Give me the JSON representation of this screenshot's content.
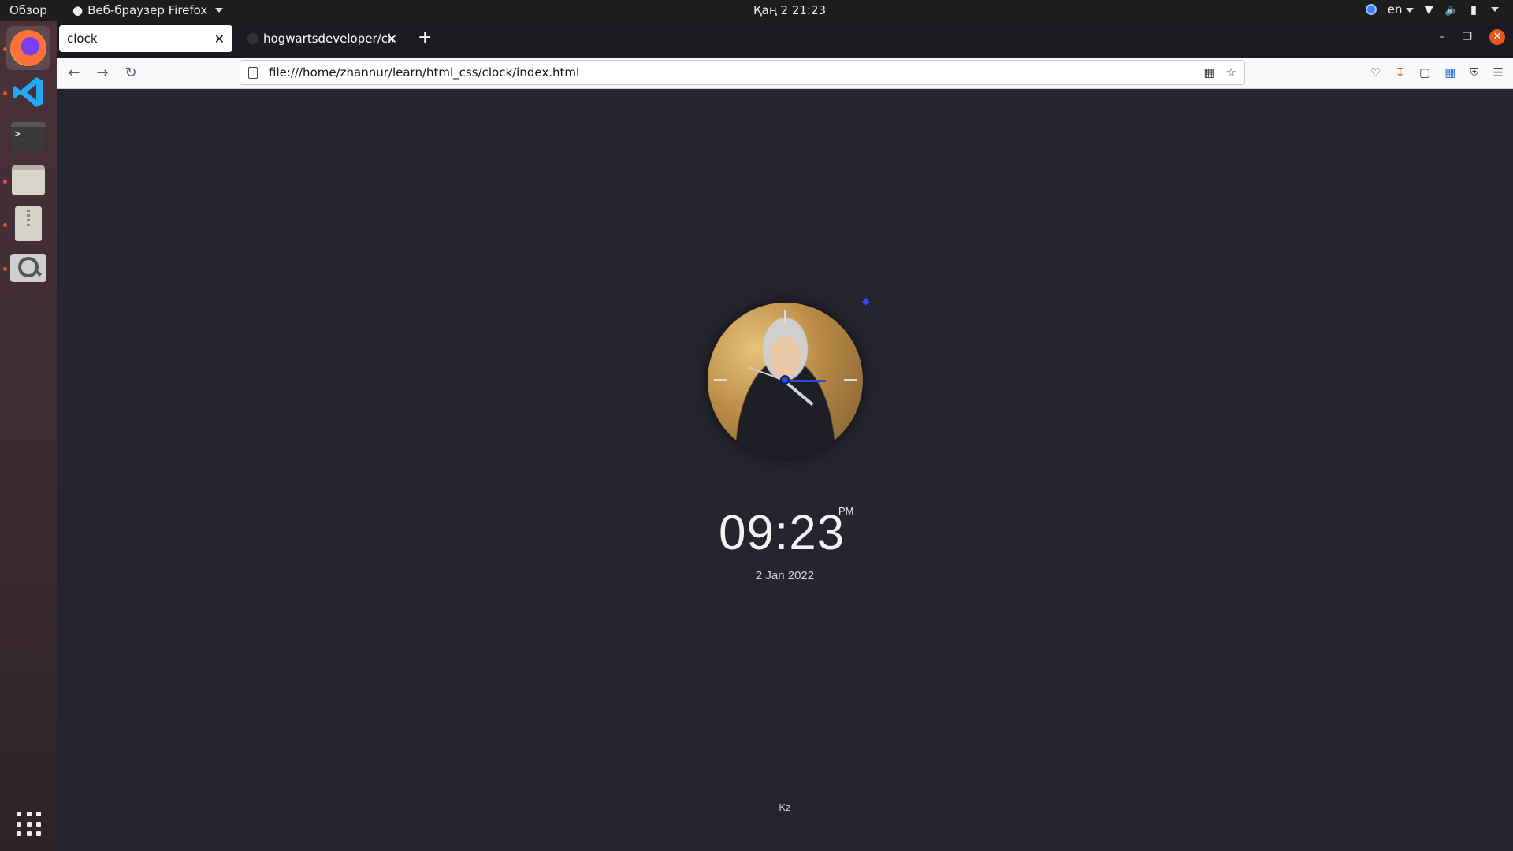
{
  "topbar": {
    "overview": "Обзор",
    "app_menu": "Веб-браузер Firefox",
    "clock": "Қаң 2  21:23",
    "lang": "en"
  },
  "dock": {
    "apps": [
      "firefox-icon",
      "vscode-icon",
      "terminal-icon",
      "files-icon",
      "archive-manager-icon",
      "image-viewer-icon"
    ]
  },
  "browser": {
    "tabs": [
      {
        "title": "clock",
        "active": true
      },
      {
        "title": "hogwartsdeveloper/clock",
        "active": false
      }
    ],
    "url": "file:///home/zhannur/learn/html_css/clock/index.html"
  },
  "page": {
    "time": "09:23",
    "ampm": "PM",
    "date": "2 Jan 2022",
    "footer": "Kz",
    "accent": "#2d4bd6",
    "background": "#24252f"
  }
}
